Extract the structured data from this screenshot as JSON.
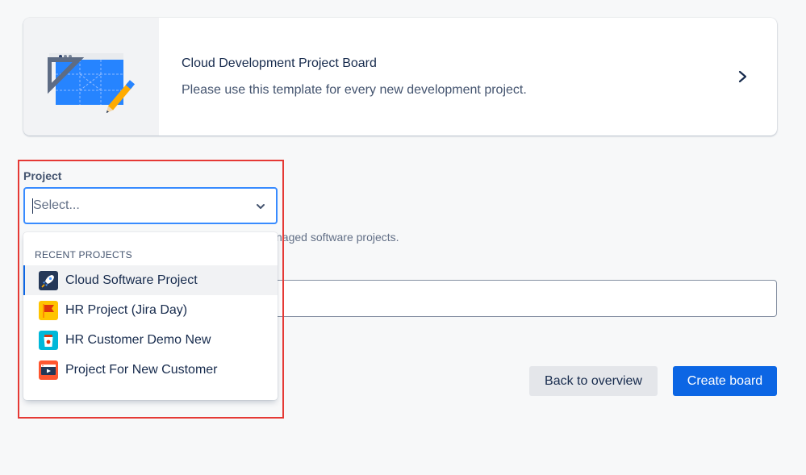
{
  "template_card": {
    "title": "Cloud Development Project Board",
    "description": "Please use this template for every new development project.",
    "thumbnail_icon": "blueprint-pencil-icon",
    "chevron_icon": "chevron-right-icon"
  },
  "project_field": {
    "label": "Project",
    "placeholder": "Select...",
    "chevron_icon": "chevron-down-icon"
  },
  "helper_text": "naged software projects.",
  "dropdown": {
    "group_label": "RECENT PROJECTS",
    "items": [
      {
        "label": "Cloud Software Project",
        "icon": "rocket-icon",
        "selected": true
      },
      {
        "label": "HR Project (Jira Day)",
        "icon": "flag-icon",
        "selected": false
      },
      {
        "label": "HR Customer Demo New",
        "icon": "coffee-cup-icon",
        "selected": false
      },
      {
        "label": "Project For New Customer",
        "icon": "presentation-icon",
        "selected": false
      }
    ]
  },
  "buttons": {
    "back_label": "Back to overview",
    "create_label": "Create board"
  },
  "colors": {
    "primary": "#0c66e4",
    "focus_border": "#388bff",
    "highlight": "#e53935"
  }
}
